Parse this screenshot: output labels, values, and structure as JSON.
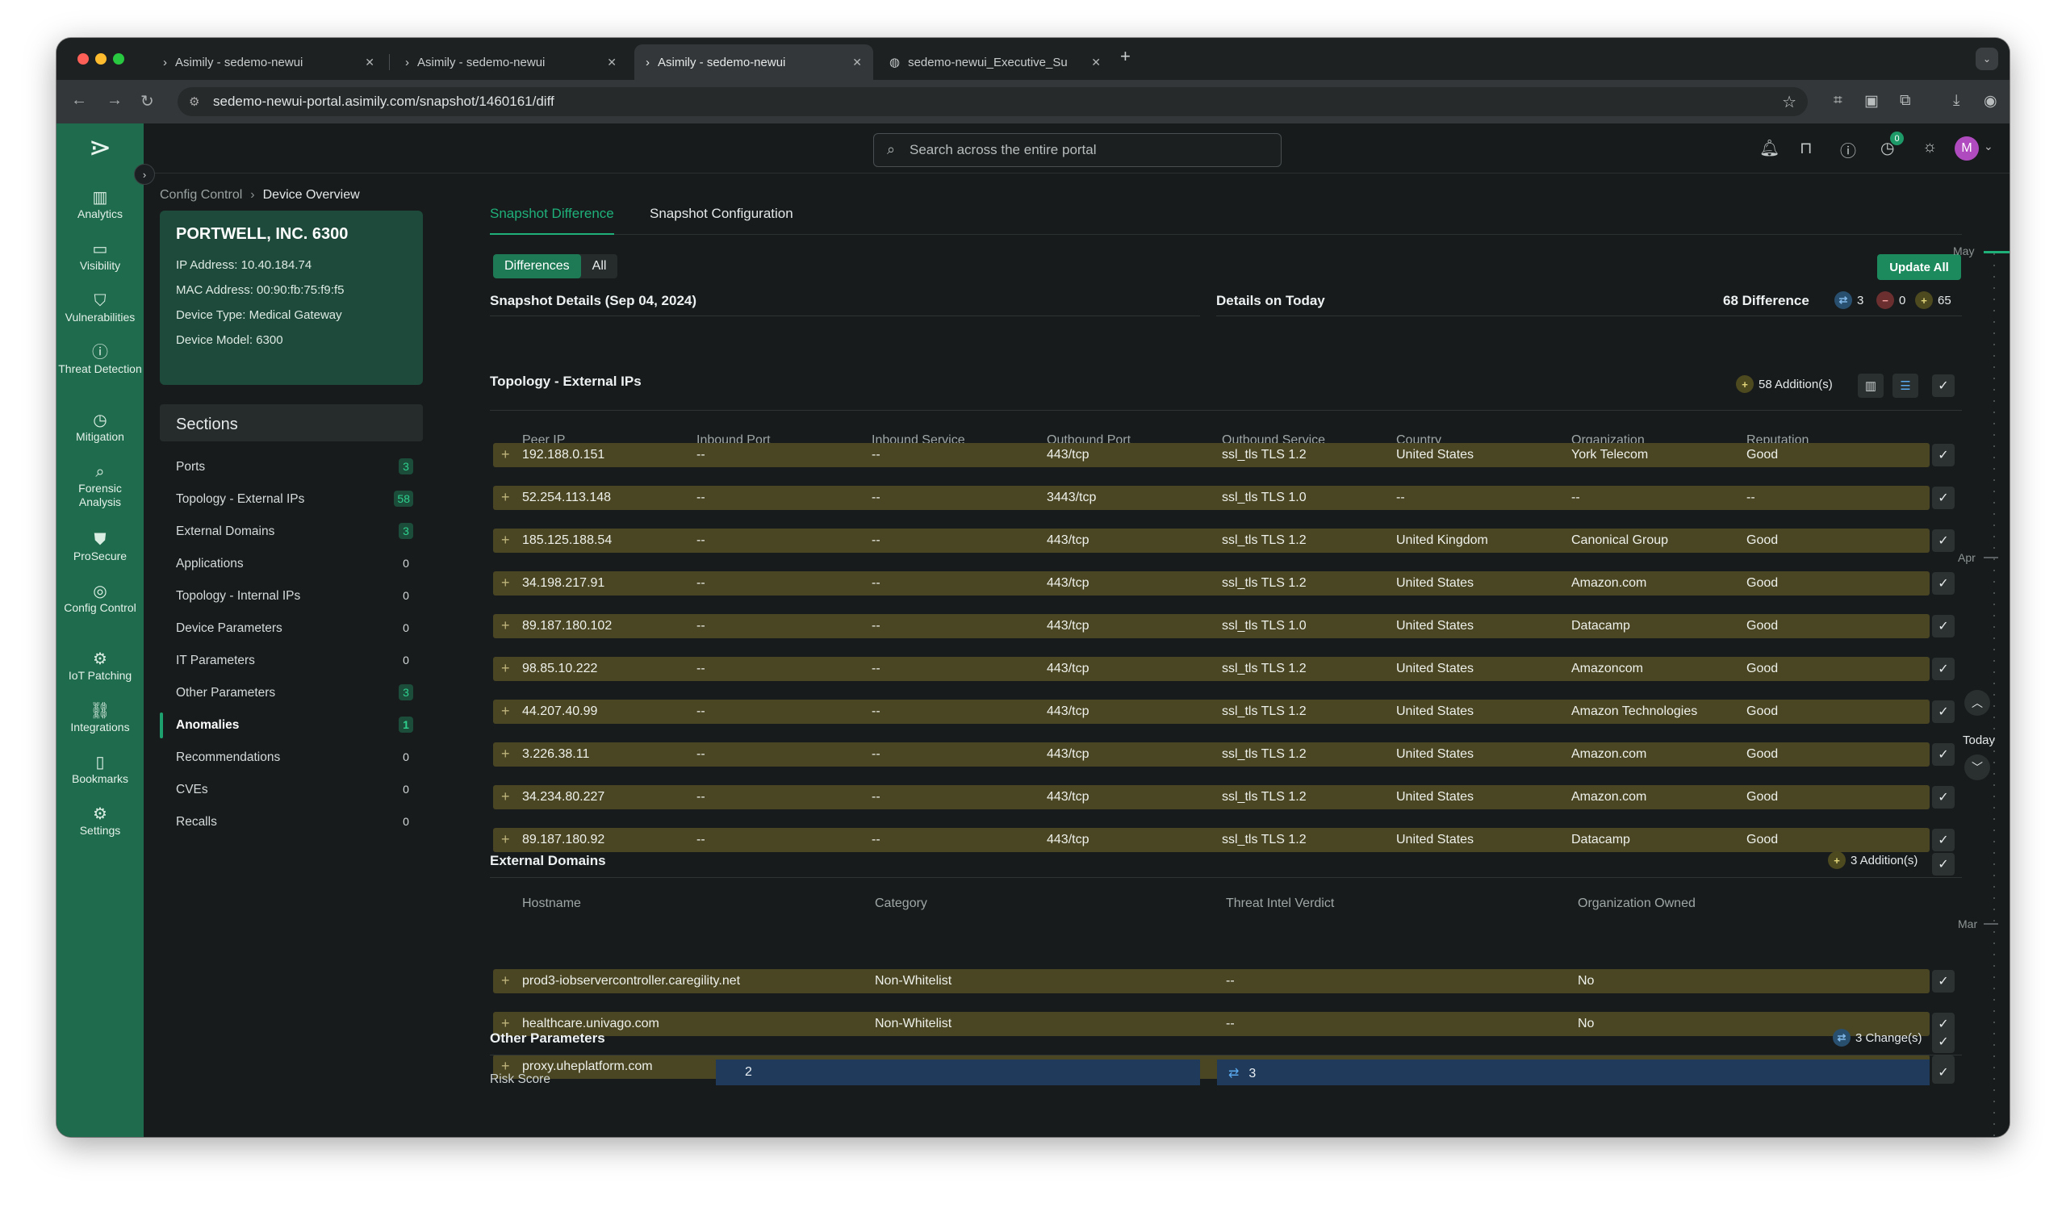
{
  "browser": {
    "tabs": [
      {
        "title": "Asimily - sedemo-newui",
        "active": false
      },
      {
        "title": "Asimily - sedemo-newui",
        "active": false
      },
      {
        "title": "Asimily - sedemo-newui",
        "active": true
      },
      {
        "title": "sedemo-newui_Executive_Su",
        "active": false
      }
    ],
    "url": "sedemo-newui-portal.asimily.com/snapshot/1460161/diff"
  },
  "appnav": {
    "items": [
      {
        "label": "Analytics",
        "icon": "analytics-icon"
      },
      {
        "label": "Visibility",
        "icon": "visibility-icon"
      },
      {
        "label": "Vulnerabilities",
        "icon": "vulnerabilities-icon"
      },
      {
        "label": "Threat Detection",
        "icon": "threat-detection-icon"
      },
      {
        "label": "Mitigation",
        "icon": "mitigation-icon"
      },
      {
        "label": "Forensic Analysis",
        "icon": "forensic-analysis-icon"
      },
      {
        "label": "ProSecure",
        "icon": "prosecure-icon"
      },
      {
        "label": "Config Control",
        "icon": "config-control-icon"
      },
      {
        "label": "IoT Patching",
        "icon": "iot-patching-icon"
      },
      {
        "label": "Integrations",
        "icon": "integrations-icon"
      },
      {
        "label": "Bookmarks",
        "icon": "bookmarks-icon"
      },
      {
        "label": "Settings",
        "icon": "settings-icon"
      }
    ]
  },
  "topbar": {
    "search_placeholder": "Search across the entire portal",
    "notification_badge": "0",
    "avatar_initial": "M"
  },
  "breadcrumb": {
    "parent": "Config Control",
    "current": "Device Overview"
  },
  "device": {
    "name": "PORTWELL, INC. 6300",
    "ip": "IP Address: 10.40.184.74",
    "mac": "MAC Address: 00:90:fb:75:f9:f5",
    "type": "Device Type: Medical Gateway",
    "model": "Device Model: 6300"
  },
  "sections": {
    "title": "Sections",
    "items": [
      {
        "label": "Ports",
        "count": "3",
        "positive": true
      },
      {
        "label": "Topology - External IPs",
        "count": "58",
        "positive": true
      },
      {
        "label": "External Domains",
        "count": "3",
        "positive": true
      },
      {
        "label": "Applications",
        "count": "0",
        "positive": false
      },
      {
        "label": "Topology - Internal IPs",
        "count": "0",
        "positive": false
      },
      {
        "label": "Device Parameters",
        "count": "0",
        "positive": false
      },
      {
        "label": "IT Parameters",
        "count": "0",
        "positive": false
      },
      {
        "label": "Other Parameters",
        "count": "3",
        "positive": true
      },
      {
        "label": "Anomalies",
        "count": "1",
        "positive": true,
        "active": true
      },
      {
        "label": "Recommendations",
        "count": "0",
        "positive": false
      },
      {
        "label": "CVEs",
        "count": "0",
        "positive": false
      },
      {
        "label": "Recalls",
        "count": "0",
        "positive": false
      }
    ]
  },
  "main": {
    "tabs": [
      "Snapshot Difference",
      "Snapshot Configuration"
    ],
    "toggle": [
      "Differences",
      "All"
    ],
    "update_all": "Update All",
    "snapshot_title": "Snapshot Details (Sep 04, 2024)",
    "details_title": "Details on Today",
    "diff_count": "68 Difference",
    "changes": "3",
    "removals": "0",
    "additions": "65"
  },
  "topology": {
    "title": "Topology - External IPs",
    "additions": "58 Addition(s)",
    "columns": [
      "Peer IP",
      "Inbound Port",
      "Inbound Service",
      "Outbound Port",
      "Outbound Service",
      "Country",
      "Organization",
      "Reputation"
    ],
    "rows": [
      [
        "192.188.0.151",
        "--",
        "--",
        "443/tcp",
        "ssl_tls TLS 1.2",
        "United States",
        "York Telecom",
        "Good"
      ],
      [
        "52.254.113.148",
        "--",
        "--",
        "3443/tcp",
        "ssl_tls TLS 1.0",
        "--",
        "--",
        "--"
      ],
      [
        "185.125.188.54",
        "--",
        "--",
        "443/tcp",
        "ssl_tls TLS 1.2",
        "United Kingdom",
        "Canonical Group",
        "Good"
      ],
      [
        "34.198.217.91",
        "--",
        "--",
        "443/tcp",
        "ssl_tls TLS 1.2",
        "United States",
        "Amazon.com",
        "Good"
      ],
      [
        "89.187.180.102",
        "--",
        "--",
        "443/tcp",
        "ssl_tls TLS 1.0",
        "United States",
        "Datacamp",
        "Good"
      ],
      [
        "98.85.10.222",
        "--",
        "--",
        "443/tcp",
        "ssl_tls TLS 1.2",
        "United States",
        "Amazoncom",
        "Good"
      ],
      [
        "44.207.40.99",
        "--",
        "--",
        "443/tcp",
        "ssl_tls TLS 1.2",
        "United States",
        "Amazon Technologies",
        "Good"
      ],
      [
        "3.226.38.11",
        "--",
        "--",
        "443/tcp",
        "ssl_tls TLS 1.2",
        "United States",
        "Amazon.com",
        "Good"
      ],
      [
        "34.234.80.227",
        "--",
        "--",
        "443/tcp",
        "ssl_tls TLS 1.2",
        "United States",
        "Amazon.com",
        "Good"
      ],
      [
        "89.187.180.92",
        "--",
        "--",
        "443/tcp",
        "ssl_tls TLS 1.2",
        "United States",
        "Datacamp",
        "Good"
      ]
    ]
  },
  "domains": {
    "title": "External Domains",
    "additions": "3 Addition(s)",
    "columns": [
      "Hostname",
      "Category",
      "Threat Intel Verdict",
      "Organization Owned"
    ],
    "rows": [
      [
        "prod3-iobservercontroller.caregility.net",
        "Non-Whitelist",
        "--",
        "No"
      ],
      [
        "healthcare.univago.com",
        "Non-Whitelist",
        "--",
        "No"
      ],
      [
        "proxy.uheplatform.com",
        "Non-Whitelist",
        "--",
        "No"
      ]
    ]
  },
  "other": {
    "title": "Other Parameters",
    "changes": "3 Change(s)",
    "risk_label": "Risk Score",
    "risk_old": "2",
    "risk_new": "3"
  },
  "timeline": {
    "months": [
      "May",
      "Apr",
      "Mar"
    ],
    "today": "Today"
  }
}
